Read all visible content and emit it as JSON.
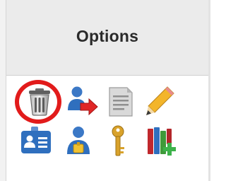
{
  "header": {
    "title": "Options"
  },
  "icons": [
    {
      "name": "trash-icon",
      "row": 1,
      "col": 1
    },
    {
      "name": "user-move-icon",
      "row": 1,
      "col": 2
    },
    {
      "name": "document-icon",
      "row": 1,
      "col": 3
    },
    {
      "name": "pencil-icon",
      "row": 1,
      "col": 4
    },
    {
      "name": "id-card-icon",
      "row": 2,
      "col": 1
    },
    {
      "name": "user-badge-icon",
      "row": 2,
      "col": 2
    },
    {
      "name": "key-icon",
      "row": 2,
      "col": 3
    },
    {
      "name": "books-add-icon",
      "row": 2,
      "col": 4
    }
  ],
  "colors": {
    "highlight": "#e21b1b",
    "header_bg": "#ebebeb"
  }
}
